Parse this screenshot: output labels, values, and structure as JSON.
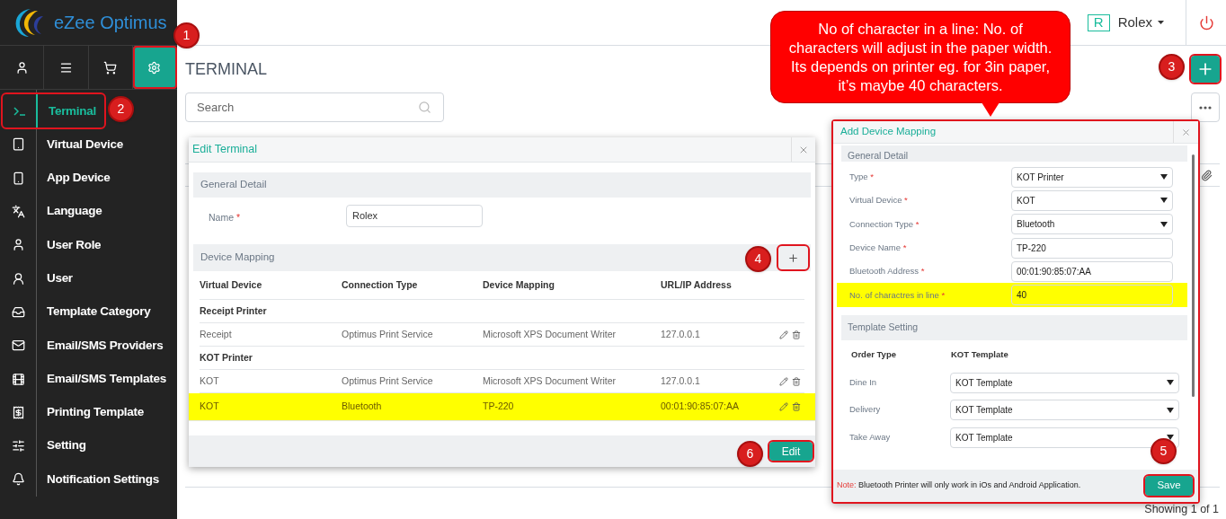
{
  "logo": {
    "text": "eZee Optimus"
  },
  "sidebar": {
    "tabs": [
      {
        "selected": false,
        "outlined": false
      },
      {
        "selected": false,
        "outlined": false
      },
      {
        "selected": false,
        "outlined": false
      },
      {
        "selected": true,
        "outlined": true
      }
    ],
    "items": [
      {
        "label": "Terminal",
        "selected": true,
        "outlined": true
      },
      {
        "label": "Virtual Device",
        "selected": false,
        "outlined": false
      },
      {
        "label": "App Device",
        "selected": false,
        "outlined": false
      },
      {
        "label": "Language",
        "selected": false,
        "outlined": false
      },
      {
        "label": "User Role",
        "selected": false,
        "outlined": false
      },
      {
        "label": "User",
        "selected": false,
        "outlined": false
      },
      {
        "label": "Template Category",
        "selected": false,
        "outlined": false
      },
      {
        "label": "Email/SMS Providers",
        "selected": false,
        "outlined": false
      },
      {
        "label": "Email/SMS Templates",
        "selected": false,
        "outlined": false
      },
      {
        "label": "Printing Template",
        "selected": false,
        "outlined": false
      },
      {
        "label": "Setting",
        "selected": false,
        "outlined": false
      },
      {
        "label": "Notification Settings",
        "selected": false,
        "outlined": false
      }
    ]
  },
  "header": {
    "user_initial": "R",
    "user_name": "Rolex"
  },
  "page": {
    "title": "TERMINAL",
    "search": {
      "placeholder": "Search"
    },
    "add_outlined": true,
    "footer": "Showing 1 of 1"
  },
  "edit_terminal": {
    "title": "Edit Terminal",
    "general_title": "General Detail",
    "name_label": "Name",
    "required_mark": "*",
    "name_value": "Rolex",
    "mapping_title": "Device Mapping",
    "add_outlined": true,
    "columns": [
      "Virtual Device",
      "Connection Type",
      "Device Mapping",
      "URL/IP Address"
    ],
    "groups": [
      {
        "name": "Receipt Printer",
        "rows": [
          {
            "cells": [
              "Receipt",
              "Optimus Print Service",
              "Microsoft XPS Document Writer",
              "127.0.0.1"
            ],
            "highlighted": false
          }
        ]
      },
      {
        "name": "KOT Printer",
        "rows": [
          {
            "cells": [
              "KOT",
              "Optimus Print Service",
              "Microsoft XPS Document Writer",
              "127.0.0.1"
            ],
            "highlighted": false
          },
          {
            "cells": [
              "KOT",
              "Bluetooth",
              "TP-220",
              "00:01:90:85:07:AA"
            ],
            "highlighted": true
          }
        ]
      }
    ],
    "button": "Edit",
    "button_outlined": true
  },
  "add_device_mapping": {
    "title": "Add Device Mapping",
    "outlined": true,
    "general_title": "General Detail",
    "fields": [
      {
        "label": "Type",
        "required_mark": "*",
        "kind": "select",
        "value": "KOT Printer",
        "highlighted": false
      },
      {
        "label": "Virtual Device",
        "required_mark": "*",
        "kind": "select",
        "value": "KOT",
        "highlighted": false
      },
      {
        "label": "Connection Type",
        "required_mark": "*",
        "kind": "select",
        "value": "Bluetooth",
        "highlighted": false
      },
      {
        "label": "Device Name",
        "required_mark": "*",
        "kind": "input",
        "value": "TP-220",
        "highlighted": false
      },
      {
        "label": "Bluetooth Address",
        "required_mark": "*",
        "kind": "input",
        "value": "00:01:90:85:07:AA",
        "highlighted": false
      },
      {
        "label": "No. of charactres in line",
        "required_mark": "*",
        "kind": "input",
        "value": "40",
        "highlighted": true
      }
    ],
    "template_title": "Template Setting",
    "template_columns": [
      "Order Type",
      "KOT Template"
    ],
    "templates": [
      {
        "label": "Dine In",
        "value": "KOT Template"
      },
      {
        "label": "Delivery",
        "value": "KOT Template"
      },
      {
        "label": "Take Away",
        "value": "KOT Template"
      }
    ],
    "note_label": "Note:",
    "note": "Bluetooth Printer will only work in iOs and Android Application.",
    "button": "Save",
    "button_outlined": true
  },
  "callout": {
    "text": "No of character in a line: No. of characters will adjust in the paper width. Its depends on printer eg. for 3in paper, it’s maybe 40 characters."
  },
  "markers": [
    "1",
    "2",
    "3",
    "4",
    "5",
    "6"
  ]
}
